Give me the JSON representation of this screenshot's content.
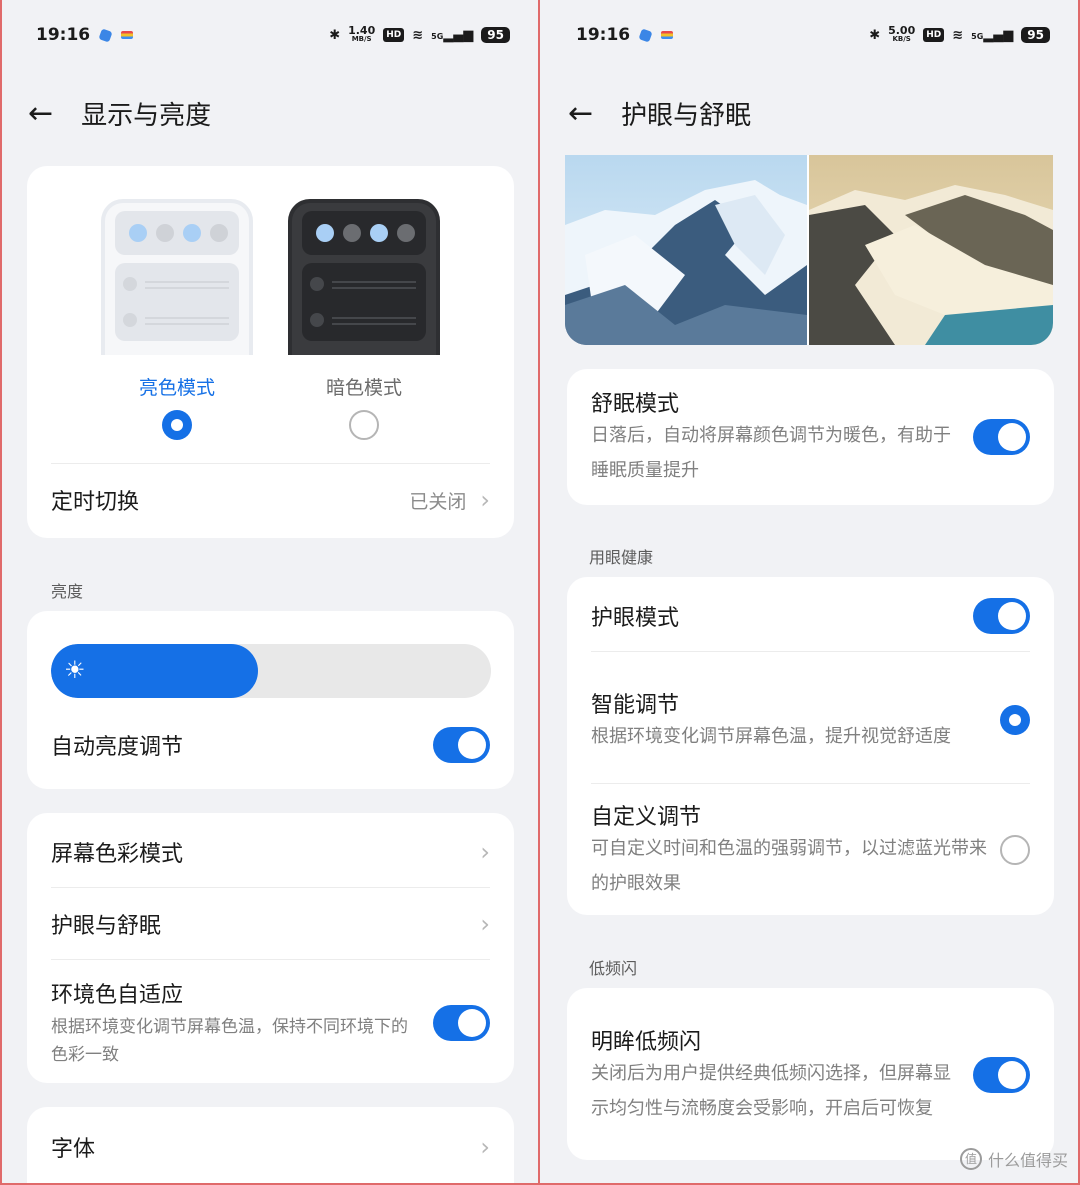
{
  "left": {
    "status": {
      "time": "19:16",
      "net_speed": "1.40",
      "net_unit": "MB/S",
      "hd": "HD",
      "signal": "5G",
      "battery": "95"
    },
    "title": "显示与亮度",
    "modes": [
      {
        "label": "亮色模式",
        "selected": true
      },
      {
        "label": "暗色模式",
        "selected": false
      }
    ],
    "scheduled": {
      "label": "定时切换",
      "value": "已关闭"
    },
    "brightness_section": "亮度",
    "brightness": {
      "level": 0.47,
      "auto_label": "自动亮度调节",
      "auto_on": true
    },
    "menu": [
      {
        "label": "屏幕色彩模式"
      },
      {
        "label": "护眼与舒眠"
      }
    ],
    "ambient": {
      "title": "环境色自适应",
      "desc": "根据环境变化调节屏幕色温，保持不同环境下的色彩一致",
      "on": true
    },
    "font": {
      "label": "字体"
    }
  },
  "right": {
    "status": {
      "time": "19:16",
      "net_speed": "5.00",
      "net_unit": "KB/S",
      "hd": "HD",
      "signal": "5G",
      "battery": "95"
    },
    "title": "护眼与舒眠",
    "sleep": {
      "title": "舒眠模式",
      "desc": "日落后，自动将屏幕颜色调节为暖色，有助于睡眠质量提升",
      "on": true
    },
    "eye_section": "用眼健康",
    "eye_mode": {
      "label": "护眼模式",
      "on": true
    },
    "smart": {
      "title": "智能调节",
      "desc": "根据环境变化调节屏幕色温，提升视觉舒适度",
      "selected": true
    },
    "custom": {
      "title": "自定义调节",
      "desc": "可自定义时间和色温的强弱调节，以过滤蓝光带来的护眼效果",
      "selected": false
    },
    "flicker_section": "低频闪",
    "flicker": {
      "title": "明眸低频闪",
      "desc": "关闭后为用户提供经典低频闪选择，但屏幕显示均匀性与流畅度会受影响，开启后可恢复",
      "on": true
    }
  },
  "watermark": "什么值得买",
  "colors": {
    "accent": "#1570e6",
    "frame": "#e06a6a"
  }
}
